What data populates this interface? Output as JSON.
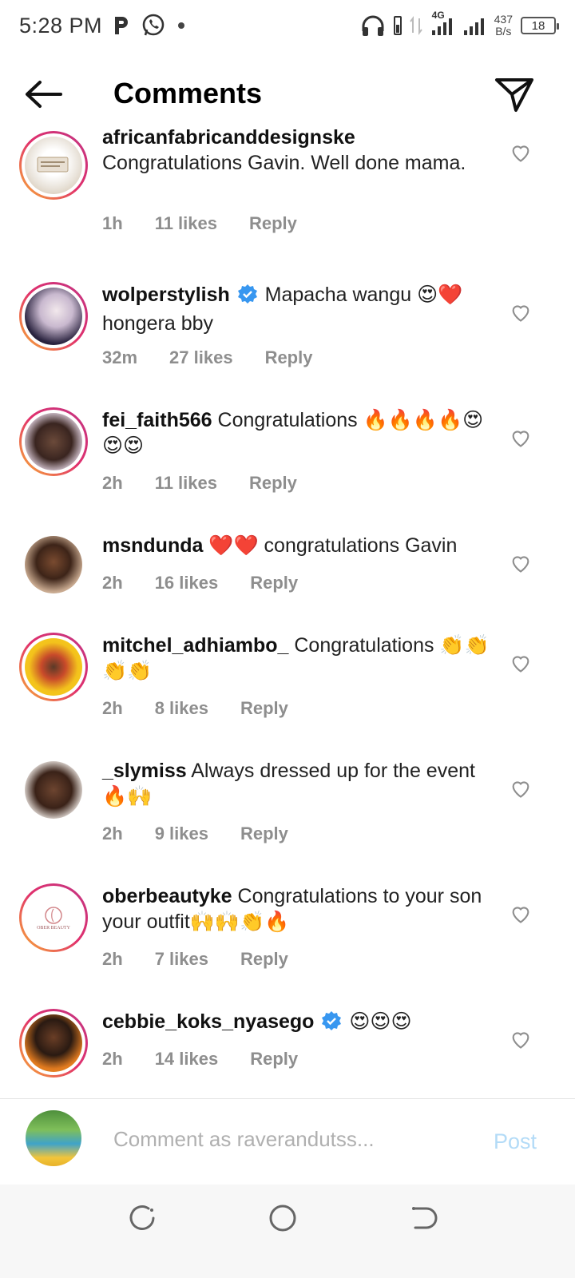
{
  "status_bar": {
    "time": "5:28 PM",
    "network_label": "4G",
    "speed_value": "437",
    "speed_unit": "B/s",
    "battery": "18",
    "icons": [
      "p-app-icon",
      "whatsapp-icon",
      "dot-icon",
      "headphones-icon",
      "battery-small-icon",
      "data-arrows-icon",
      "signal-icon",
      "signal-icon-2",
      "battery-icon"
    ]
  },
  "header": {
    "title": "Comments",
    "back_icon": "back-arrow-icon",
    "share_icon": "send-icon"
  },
  "comments": [
    {
      "username": "africanfabricanddesignske",
      "verified": false,
      "text": "Congratulations Gavin. Well done mama.",
      "time": "1h",
      "likes": "11 likes",
      "reply": "Reply"
    },
    {
      "username": "wolperstylish",
      "verified": true,
      "text": "Mapacha wangu 😍❤️ hongera bby",
      "time": "32m",
      "likes": "27 likes",
      "reply": "Reply"
    },
    {
      "username": "fei_faith566",
      "verified": false,
      "text": "Congratulations 🔥🔥🔥🔥😍😍😍",
      "time": "2h",
      "likes": "11 likes",
      "reply": "Reply"
    },
    {
      "username": "msndunda",
      "verified": false,
      "text": "❤️❤️ congratulations Gavin",
      "time": "2h",
      "likes": "16 likes",
      "reply": "Reply"
    },
    {
      "username": "mitchel_adhiambo_",
      "verified": false,
      "text": "Congratulations 👏👏👏👏",
      "time": "2h",
      "likes": "8 likes",
      "reply": "Reply"
    },
    {
      "username": "_slymiss",
      "verified": false,
      "text": "Always dressed up for the event 🔥🙌",
      "time": "2h",
      "likes": "9 likes",
      "reply": "Reply"
    },
    {
      "username": "oberbeautyke",
      "verified": false,
      "text": "Congratulations to your son your outfit🙌🙌👏🔥",
      "time": "2h",
      "likes": "7 likes",
      "reply": "Reply"
    },
    {
      "username": "cebbie_koks_nyasego",
      "verified": true,
      "text": "😍😍😍",
      "time": "2h",
      "likes": "14 likes",
      "reply": "Reply"
    }
  ],
  "avatar_logo_text": "OBER BEAUTY",
  "compose": {
    "placeholder": "Comment as raverandutss...",
    "post_label": "Post"
  },
  "nav": {
    "recent_icon": "recent-apps-icon",
    "home_icon": "home-circle-icon",
    "back_icon": "nav-back-icon"
  },
  "colors": {
    "meta_text": "#8e8e8e",
    "verified_blue": "#3897f0",
    "post_disabled": "#b3dbf7",
    "ring_gradient_start": "#f9b233",
    "ring_gradient_end": "#c13584"
  }
}
